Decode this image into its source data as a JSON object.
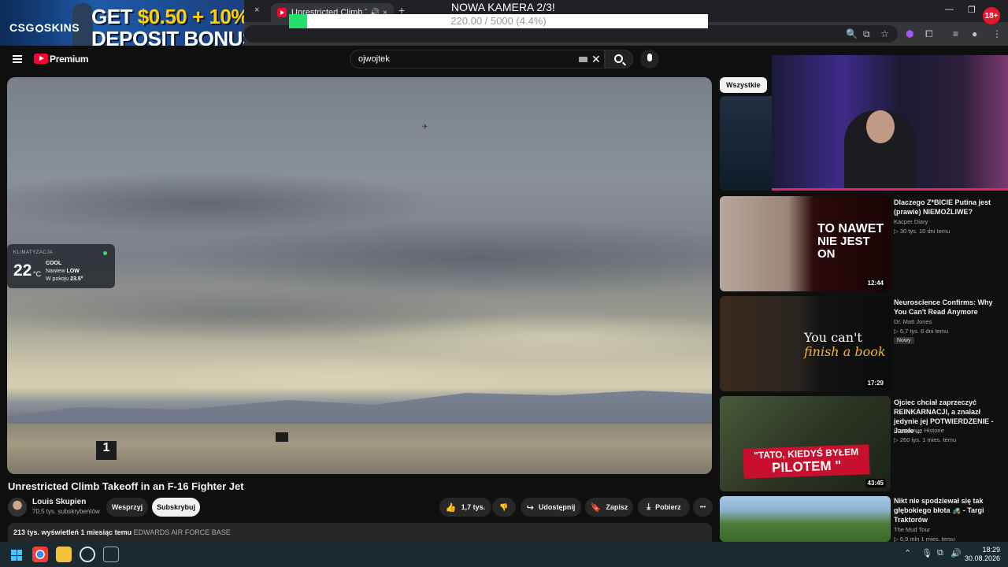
{
  "browser": {
    "active_tab_title": "Unrestricted Climb Takeoff",
    "tab_icons": [
      "volume-icon",
      "close-icon"
    ],
    "new_tab": "+",
    "close_glyph": "×",
    "window_controls": [
      "—",
      "❐",
      "✕"
    ]
  },
  "overlay": {
    "ad_brand": "CSG",
    "ad_brand_suffix": "SKINS",
    "ad_line1_prefix": "GET",
    "ad_line1_amount": "$0.50 + 10%",
    "ad_line2": "DEPOSIT BONUS",
    "camera_title": "NOWA KAMERA 2/3!",
    "goal_text": "220.00 / 5000 (4.4%)",
    "goal_fraction": 0.044,
    "age_badge": "18+"
  },
  "youtube": {
    "logo_text": "Premium",
    "search_value": "ojwojtek"
  },
  "video": {
    "title": "Unrestricted Climb Takeoff in an F-16 Fighter Jet",
    "sign_label": "1",
    "channel_name": "Louis Skupien",
    "channel_subs": "70,5 tys. subskrybentów",
    "support_label": "Wesprzyj",
    "subscribe_label": "Subskrybuj",
    "likes": "1,7 tys.",
    "share_label": "Udostępnij",
    "save_label": "Zapisz",
    "download_label": "Pobierz",
    "more_glyph": "•••",
    "views_line": "213 tys. wyświetleń  1 miesiąc temu",
    "location": "EDWARDS AIR FORCE BASE"
  },
  "climate": {
    "label": "KLIMATYZACJA",
    "temp": "22",
    "unit": "°C",
    "mode": "COOL",
    "fan_label": "Nawiew",
    "fan_value": "LOW",
    "room_label": "W pokoju",
    "room_value": "23.5°"
  },
  "sidebar": {
    "chip": "Wszystkie",
    "items": [
      {
        "title": "Dlaczego Z*BICIE Putina jest (prawie) NIEMOŻLIWE?",
        "channel": "Kacper Diary",
        "meta": "▷ 30 tys.  10 dni temu",
        "duration": "12:44",
        "thumb_text_1": "TO NAWET",
        "thumb_text_2": "NIE JEST ON"
      },
      {
        "title": "Neuroscience Confirms: Why You Can't Read Anymore",
        "channel": "Dr. Matt Jones",
        "meta": "▷ 6,7 tys.  6 dni temu",
        "badge": "Nowy",
        "duration": "17:29",
        "thumb_text_1": "You can't",
        "thumb_text_2": "finish a book"
      },
      {
        "title": "Ojciec chciał zaprzeczyć REINKARNACJI, a znalazł jedynie jej POTWIERDZENIE - Jamie ...",
        "channel": "Prawdziwe Historie",
        "meta": "▷ 260 tys.  1 mies. temu",
        "duration": "43:45",
        "thumb_text_1": "\"TATO, KIEDYŚ BYŁEM",
        "thumb_text_2": "PILOTEM \""
      },
      {
        "title": "Nikt nie spodziewał się tak głębokiego błota 🚜 - Targi Traktorów",
        "channel": "The Mud Tour",
        "meta": "▷ 6,9 mln  1 mies. temu"
      }
    ]
  },
  "taskbar": {
    "time": "18:29",
    "date": "30.08.2026"
  }
}
